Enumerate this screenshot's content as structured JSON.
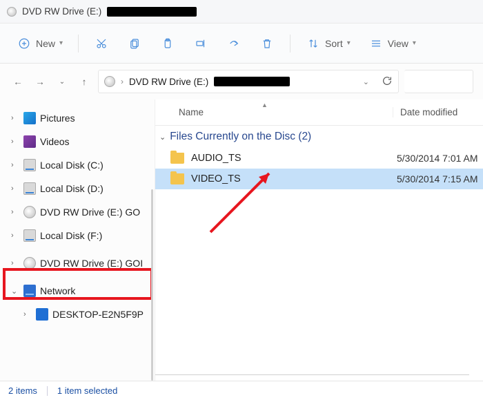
{
  "window": {
    "title_prefix": "DVD RW Drive (E:)"
  },
  "toolbar": {
    "new": "New",
    "sort": "Sort",
    "view": "View"
  },
  "address": {
    "segment": "DVD RW Drive (E:)"
  },
  "tree": {
    "items": [
      {
        "label": "Pictures",
        "icon": "pics",
        "sub": false,
        "expander": ">"
      },
      {
        "label": "Videos",
        "icon": "vid",
        "sub": false,
        "expander": ">"
      },
      {
        "label": "Local Disk (C:)",
        "icon": "drive",
        "sub": false,
        "expander": ">"
      },
      {
        "label": "Local Disk (D:)",
        "icon": "drive",
        "sub": false,
        "expander": ">"
      },
      {
        "label": "DVD RW Drive (E:) GO",
        "icon": "disc",
        "sub": false,
        "expander": ">"
      },
      {
        "label": "Local Disk (F:)",
        "icon": "drive",
        "sub": false,
        "expander": ">"
      },
      {
        "label": "DVD RW Drive (E:) GOI",
        "icon": "disc",
        "sub": false,
        "expander": ">",
        "highlighted": true
      },
      {
        "label": "Network",
        "icon": "net",
        "sub": false,
        "expander": "v"
      },
      {
        "label": "DESKTOP-E2N5F9P",
        "icon": "pc",
        "sub": true,
        "expander": ">"
      }
    ]
  },
  "columns": {
    "name": "Name",
    "date": "Date modified"
  },
  "group": {
    "header": "Files Currently on the Disc (2)"
  },
  "rows": [
    {
      "name": "AUDIO_TS",
      "date": "5/30/2014 7:01 AM",
      "selected": false
    },
    {
      "name": "VIDEO_TS",
      "date": "5/30/2014 7:15 AM",
      "selected": true
    }
  ],
  "status": {
    "count": "2 items",
    "selection": "1 item selected"
  },
  "colors": {
    "highlight_red": "#e7161f",
    "selection": "#c5e0f9",
    "accent": "#1a4fa3"
  }
}
